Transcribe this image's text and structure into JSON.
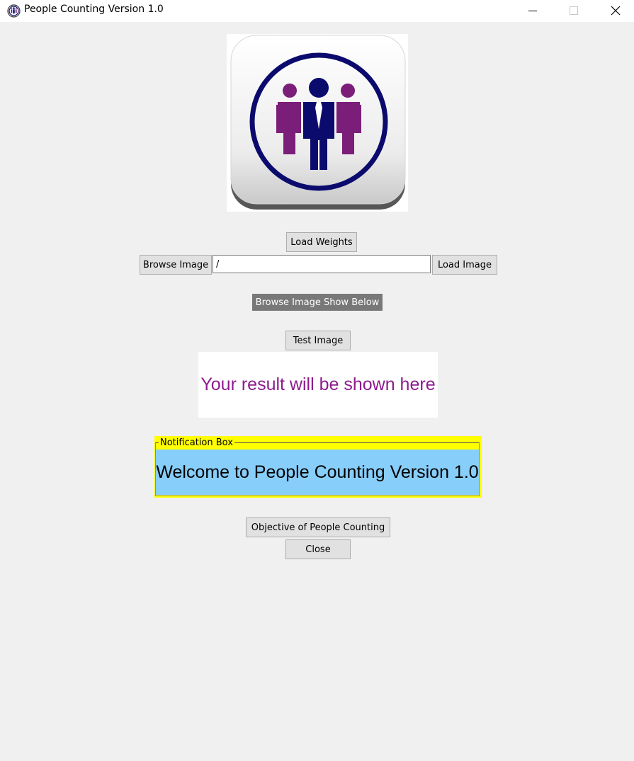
{
  "window": {
    "title": "People Counting Version 1.0",
    "app_icon": "people-counting-icon",
    "controls": {
      "minimize_icon": "minimize-icon",
      "maximize_icon": "maximize-icon",
      "close_icon": "close-icon"
    }
  },
  "logo": {
    "icon": "people-group-logo",
    "colors": {
      "ring": "#0b0b6e",
      "center_person": "#0b0b6e",
      "side_people": "#7b1e7a"
    }
  },
  "buttons": {
    "load_weights": "Load Weights",
    "browse_image": "Browse Image",
    "load_image": "Load Image",
    "test_image": "Test Image",
    "objective": "Objective of People Counting",
    "close": "Close"
  },
  "image_path": {
    "value": "/"
  },
  "browse_caption": "Browse Image Show Below",
  "result_text": "Your result will be shown here",
  "notification": {
    "label": "Notification Box",
    "message": "Welcome to People Counting Version 1.0"
  },
  "colors": {
    "background": "#f0f0f0",
    "result_text": "#8e1b8e",
    "notification_label_bg": "#ffff00",
    "notification_msg_bg": "#87cefa",
    "caption_bg": "#787878"
  }
}
